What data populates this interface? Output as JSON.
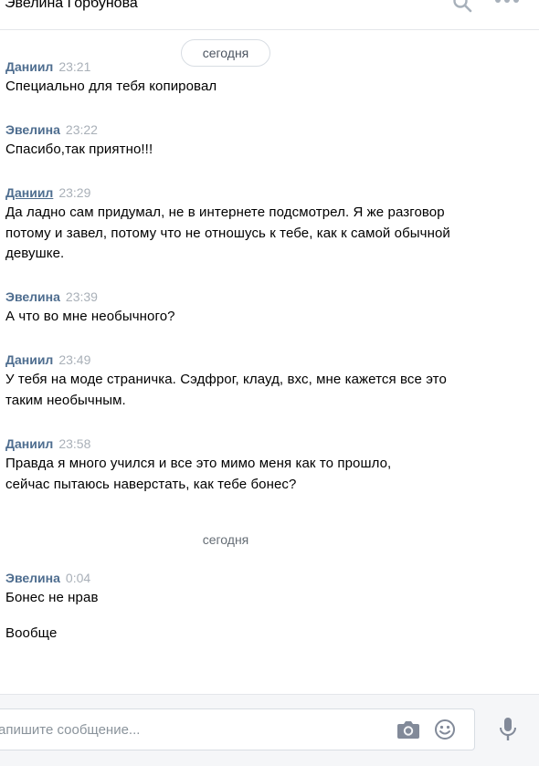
{
  "header": {
    "title": "Эвелина Горбунова"
  },
  "dates": {
    "first": "сегодня",
    "second": "сегодня"
  },
  "messages": [
    {
      "author": "Даниил",
      "time": "23:21",
      "lines": [
        "Специально для тебя копировал"
      ]
    },
    {
      "author": "Эвелина",
      "time": "23:22",
      "lines": [
        "Спасибо,так приятно!!!"
      ]
    },
    {
      "author": "Даниил",
      "time": "23:29",
      "lines": [
        "Да ладно сам придумал, не в интернете подсмотрел. Я же разговор потому и завел, потому что не отношусь к тебе, как к самой обычной девушке."
      ]
    },
    {
      "author": "Эвелина",
      "time": "23:39",
      "lines": [
        "А что во мне необычного?"
      ]
    },
    {
      "author": "Даниил",
      "time": "23:49",
      "lines": [
        "У тебя на моде страничка. Сэдфрог, клауд, вхс, мне кажется все это таким необычным."
      ]
    },
    {
      "author": "Даниил",
      "time": "23:58",
      "lines": [
        "Правда я много учился и все это мимо меня как то прошло, сейчас пытаюсь наверстать, как тебе бонес?"
      ]
    },
    {
      "author": "Эвелина",
      "time": "0:04",
      "lines": [
        "Бонес не нрав",
        "Вообще"
      ]
    }
  ],
  "composer": {
    "placeholder": "апишите сообщение..."
  },
  "colors": {
    "author": "#4e6d8f",
    "time": "#a9b0b8",
    "accent": "#828a99"
  }
}
